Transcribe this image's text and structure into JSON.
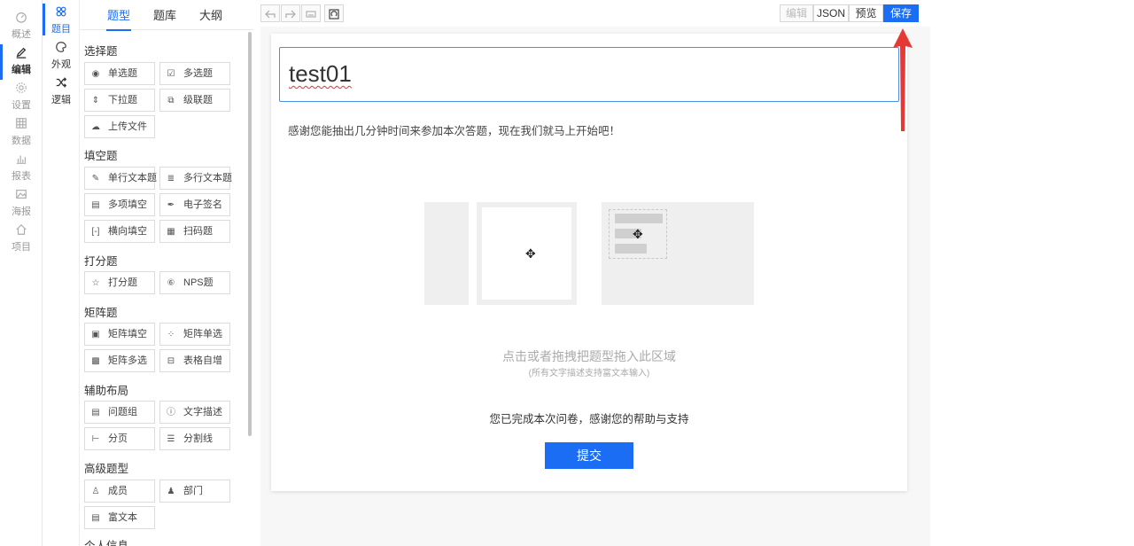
{
  "leftnav": {
    "items": [
      {
        "label": "概述",
        "icon": "dashboard-icon"
      },
      {
        "label": "编辑",
        "icon": "edit-icon"
      },
      {
        "label": "设置",
        "icon": "gear-icon"
      },
      {
        "label": "数据",
        "icon": "table-icon"
      },
      {
        "label": "报表",
        "icon": "bar-chart-icon"
      },
      {
        "label": "海报",
        "icon": "image-icon"
      },
      {
        "label": "项目",
        "icon": "home-icon"
      }
    ]
  },
  "subnav": {
    "items": [
      {
        "label": "题目",
        "icon": "apps-icon"
      },
      {
        "label": "外观",
        "icon": "palette-icon"
      },
      {
        "label": "逻辑",
        "icon": "shuffle-icon"
      }
    ]
  },
  "panel": {
    "tabs": [
      "题型",
      "题库",
      "大纲"
    ],
    "sections": [
      {
        "title": "选择题",
        "items": [
          "单选题",
          "多选题",
          "下拉题",
          "级联题",
          "上传文件"
        ]
      },
      {
        "title": "填空题",
        "items": [
          "单行文本题",
          "多行文本题",
          "多项填空",
          "电子签名",
          "横向填空",
          "扫码题"
        ]
      },
      {
        "title": "打分题",
        "items": [
          "打分题",
          "NPS题"
        ]
      },
      {
        "title": "矩阵题",
        "items": [
          "矩阵填空",
          "矩阵单选",
          "矩阵多选",
          "表格自增"
        ]
      },
      {
        "title": "辅助布局",
        "items": [
          "问题组",
          "文字描述",
          "分页",
          "分割线"
        ]
      },
      {
        "title": "高级题型",
        "items": [
          "成员",
          "部门",
          "富文本"
        ]
      },
      {
        "title": "个人信息",
        "items": []
      }
    ]
  },
  "toolbar": {
    "edit_label": "编辑",
    "json_label": "JSON",
    "preview_label": "预览",
    "save_label": "保存"
  },
  "survey": {
    "title": "test01",
    "intro": "感谢您能抽出几分钟时间来参加本次答题，现在我们就马上开始吧！",
    "drop_hint": "点击或者拖拽把题型拖入此区域",
    "drop_sub": "(所有文字描述支持富文本输入)",
    "finish_text": "您已完成本次问卷，感谢您的帮助与支持",
    "submit_label": "提交"
  },
  "colors": {
    "accent": "#1b6ef3",
    "annotation_arrow": "#e53935"
  }
}
